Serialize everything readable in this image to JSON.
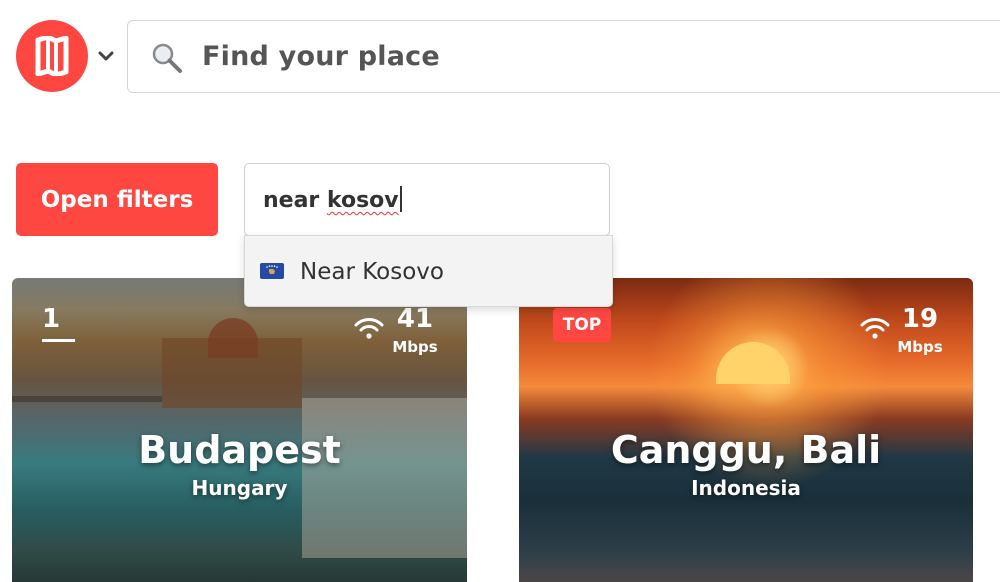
{
  "header": {
    "logo_icon": "nomad-list-logo-icon",
    "menu_icon": "chevron-down-icon",
    "search": {
      "placeholder": "Find your place",
      "icon": "search-icon"
    }
  },
  "filters": {
    "open_filters_label": "Open filters",
    "location_input": {
      "value_plain": "near ",
      "value_typo": "kosov"
    },
    "suggestions": [
      {
        "label": "Near Kosovo",
        "flag_icon": "kosovo-flag-icon"
      }
    ]
  },
  "cards": [
    {
      "rank": "1",
      "city": "Budapest",
      "country": "Hungary",
      "speed": "41",
      "speed_unit": "Mbps"
    },
    {
      "badge": "TOP",
      "city": "Canggu, Bali",
      "country": "Indonesia",
      "speed": "19",
      "speed_unit": "Mbps"
    }
  ],
  "colors": {
    "brand_red": "#ff4742"
  }
}
